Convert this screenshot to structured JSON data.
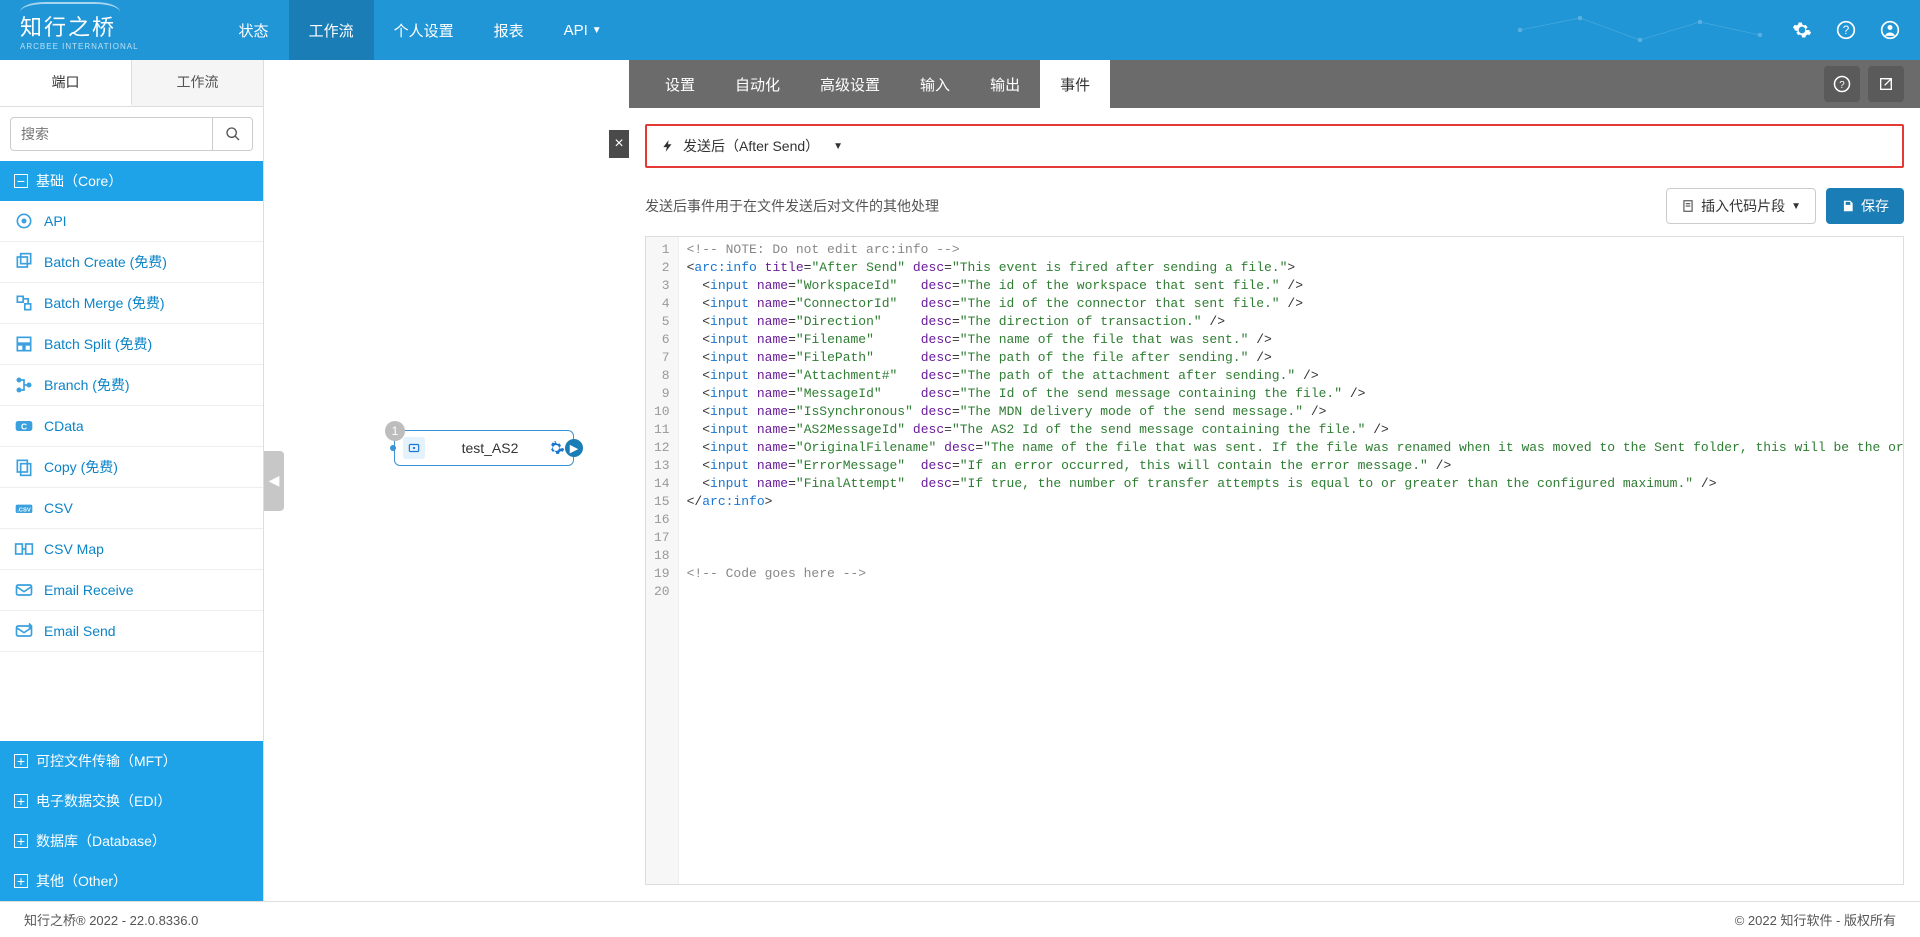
{
  "logo": {
    "main": "知行之桥",
    "sub": "ARCBEE INTERNATIONAL"
  },
  "topnav": {
    "items": [
      {
        "label": "状态"
      },
      {
        "label": "工作流"
      },
      {
        "label": "个人设置"
      },
      {
        "label": "报表"
      },
      {
        "label": "API"
      }
    ]
  },
  "sidebar": {
    "tabs": {
      "port": "端口",
      "workflow": "工作流"
    },
    "search": {
      "placeholder": "搜索"
    },
    "categories": [
      {
        "label": "基础（Core）",
        "open": true
      },
      {
        "label": "可控文件传输（MFT）",
        "open": false
      },
      {
        "label": "电子数据交换（EDI）",
        "open": false
      },
      {
        "label": "数据库（Database）",
        "open": false
      },
      {
        "label": "其他（Other）",
        "open": false
      }
    ],
    "connectors": [
      {
        "label": "API"
      },
      {
        "label": "Batch Create (免费)"
      },
      {
        "label": "Batch Merge (免费)"
      },
      {
        "label": "Batch Split (免费)"
      },
      {
        "label": "Branch (免费)"
      },
      {
        "label": "CData"
      },
      {
        "label": "Copy (免费)"
      },
      {
        "label": "CSV"
      },
      {
        "label": "CSV Map"
      },
      {
        "label": "Email Receive"
      },
      {
        "label": "Email Send"
      }
    ]
  },
  "canvas": {
    "node": {
      "title": "test_AS2",
      "badge": "1"
    }
  },
  "panel": {
    "tabs": [
      {
        "label": "设置"
      },
      {
        "label": "自动化"
      },
      {
        "label": "高级设置"
      },
      {
        "label": "输入"
      },
      {
        "label": "输出"
      },
      {
        "label": "事件"
      }
    ],
    "event_dropdown": "发送后（After Send）",
    "description": "发送后事件用于在文件发送后对文件的其他处理",
    "insert_snippet": "插入代码片段",
    "save": "保存",
    "code": [
      {
        "type": "comment",
        "text": "<!-- NOTE: Do not edit arc:info -->"
      },
      {
        "type": "open",
        "tag": "arc:info",
        "attrs": [
          [
            "title",
            "After Send"
          ],
          [
            "desc",
            "This event is fired after sending a file."
          ]
        ]
      },
      {
        "type": "self",
        "tag": "input",
        "indent": 1,
        "attrs": [
          [
            "name",
            "WorkspaceId"
          ],
          [
            "desc",
            "The id of the workspace that sent file."
          ]
        ],
        "descCol": 30
      },
      {
        "type": "self",
        "tag": "input",
        "indent": 1,
        "attrs": [
          [
            "name",
            "ConnectorId"
          ],
          [
            "desc",
            "The id of the connector that sent file."
          ]
        ],
        "descCol": 30
      },
      {
        "type": "self",
        "tag": "input",
        "indent": 1,
        "attrs": [
          [
            "name",
            "Direction"
          ],
          [
            "desc",
            "The direction of transaction."
          ]
        ],
        "descCol": 30
      },
      {
        "type": "self",
        "tag": "input",
        "indent": 1,
        "attrs": [
          [
            "name",
            "Filename"
          ],
          [
            "desc",
            "The name of the file that was sent."
          ]
        ],
        "descCol": 30
      },
      {
        "type": "self",
        "tag": "input",
        "indent": 1,
        "attrs": [
          [
            "name",
            "FilePath"
          ],
          [
            "desc",
            "The path of the file after sending."
          ]
        ],
        "descCol": 30
      },
      {
        "type": "self",
        "tag": "input",
        "indent": 1,
        "attrs": [
          [
            "name",
            "Attachment#"
          ],
          [
            "desc",
            "The path of the attachment after sending."
          ]
        ],
        "descCol": 30
      },
      {
        "type": "self",
        "tag": "input",
        "indent": 1,
        "attrs": [
          [
            "name",
            "MessageId"
          ],
          [
            "desc",
            "The Id of the send message containing the file."
          ]
        ],
        "descCol": 30
      },
      {
        "type": "self",
        "tag": "input",
        "indent": 1,
        "attrs": [
          [
            "name",
            "IsSynchronous"
          ],
          [
            "desc",
            "The MDN delivery mode of the send message."
          ]
        ],
        "descCol": 29
      },
      {
        "type": "self",
        "tag": "input",
        "indent": 1,
        "attrs": [
          [
            "name",
            "AS2MessageId"
          ],
          [
            "desc",
            "The AS2 Id of the send message containing the file."
          ]
        ],
        "descCol": 29
      },
      {
        "type": "self",
        "tag": "input",
        "indent": 1,
        "attrs": [
          [
            "name",
            "OriginalFilename"
          ],
          [
            "desc",
            "The name of the file that was sent. If the file was renamed when it was moved to the Sent folder, this will be the original name."
          ]
        ],
        "descCol": 32
      },
      {
        "type": "self",
        "tag": "input",
        "indent": 1,
        "attrs": [
          [
            "name",
            "ErrorMessage"
          ],
          [
            "desc",
            "If an error occurred, this will contain the error message."
          ]
        ],
        "descCol": 30
      },
      {
        "type": "self",
        "tag": "input",
        "indent": 1,
        "attrs": [
          [
            "name",
            "FinalAttempt"
          ],
          [
            "desc",
            "If true, the number of transfer attempts is equal to or greater than the configured maximum."
          ]
        ],
        "descCol": 30
      },
      {
        "type": "close",
        "tag": "arc:info"
      },
      {
        "type": "blank"
      },
      {
        "type": "blank"
      },
      {
        "type": "blank"
      },
      {
        "type": "comment",
        "text": "<!-- Code goes here -->"
      },
      {
        "type": "blank"
      }
    ]
  },
  "footer": {
    "left": "知行之桥® 2022 - 22.0.8336.0",
    "right": "© 2022 知行软件 - 版权所有"
  }
}
